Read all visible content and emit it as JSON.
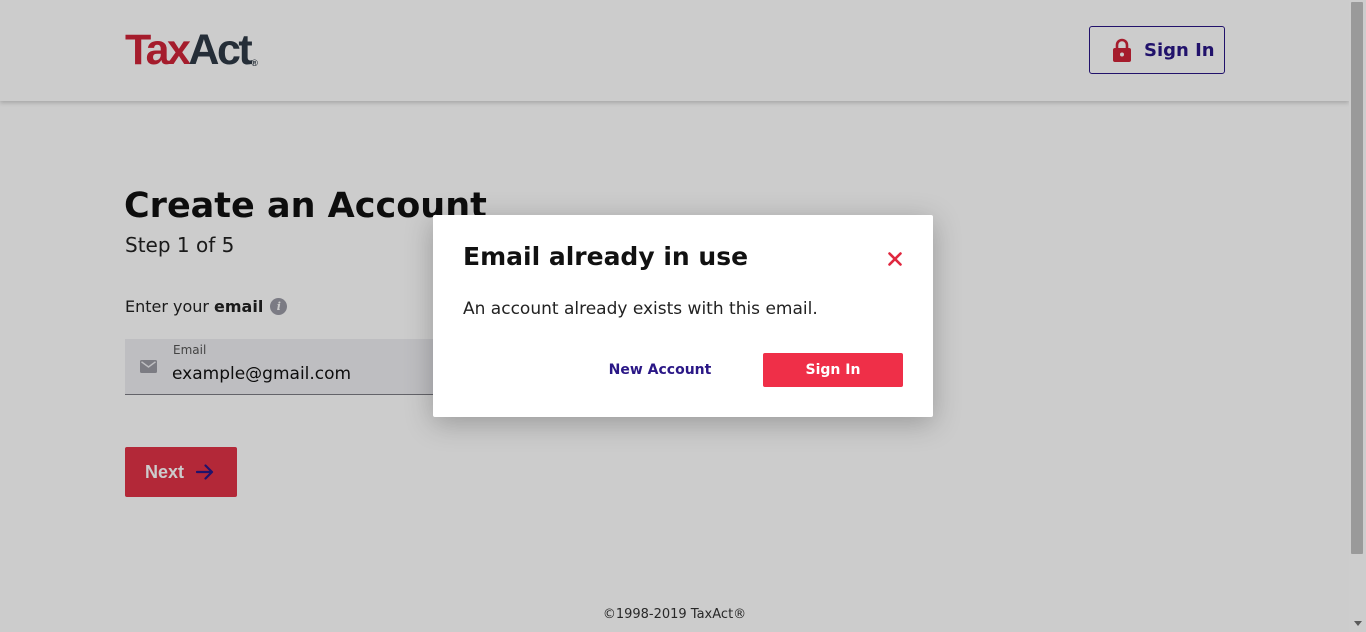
{
  "header": {
    "logo": {
      "tax": "Tax",
      "act": "Act",
      "registered": "®"
    },
    "sign_in_label": "Sign In"
  },
  "main": {
    "title": "Create an Account",
    "step": "Step 1 of 5",
    "email_prompt_prefix": "Enter your",
    "email_prompt_bold": "email",
    "info_icon": "i",
    "email_field": {
      "floating_label": "Email",
      "value": "example@gmail.com"
    },
    "next_label": "Next"
  },
  "footer": {
    "copyright": "©1998-2019 TaxAct®"
  },
  "modal": {
    "title": "Email already in use",
    "message": "An account already exists with this email.",
    "new_account_label": "New Account",
    "sign_in_label": "Sign In"
  },
  "colors": {
    "brand_red": "#cf2337",
    "brand_navy": "#2a1786",
    "button_red": "#ef2f48",
    "dark_slate": "#2f3a46"
  },
  "icons": [
    "lock-icon",
    "info-icon",
    "mail-icon",
    "arrow-right-icon",
    "close-icon"
  ]
}
